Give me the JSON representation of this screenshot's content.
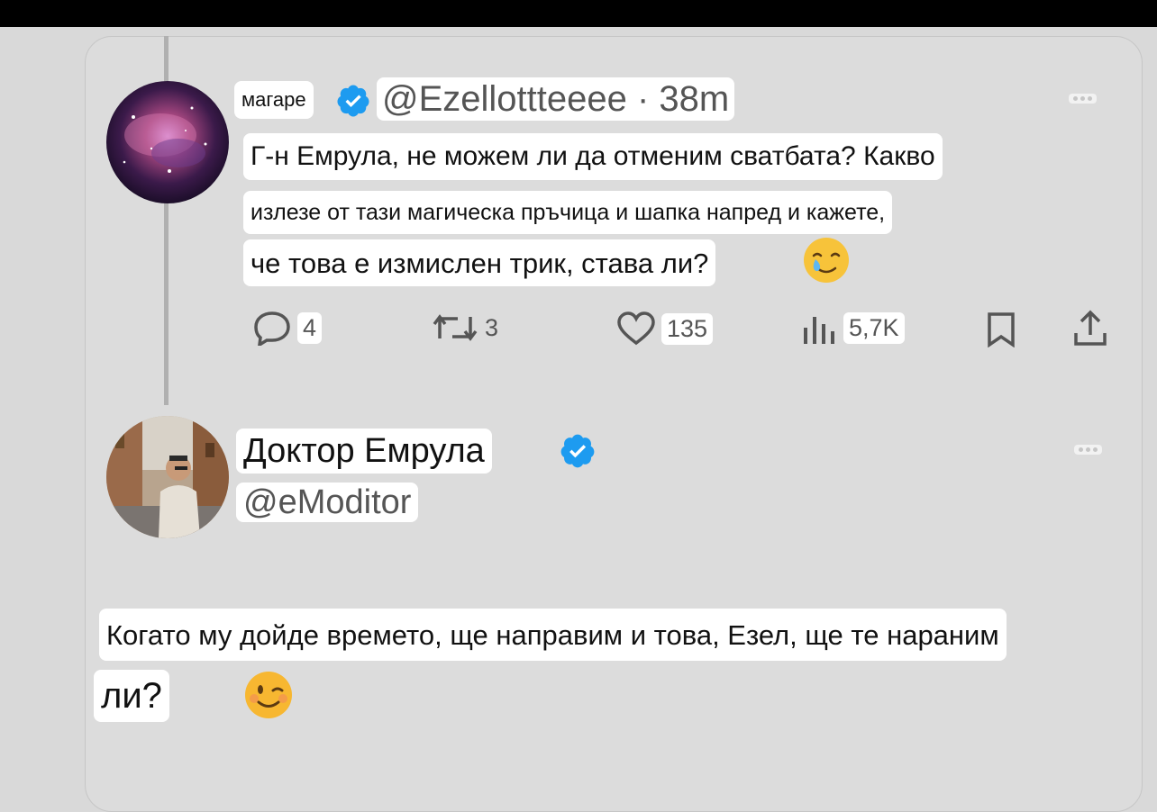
{
  "tweet1": {
    "display_name": "магаре",
    "handle_time": "@Ezellottteeee · 38m",
    "text_line1": "Г-н Емрула, не можем ли да отменим сватбата? Какво",
    "text_line2": "излезе от тази магическа пръчица и шапка напред и кажете,",
    "text_line3": "че това е измислен трик, става ли?",
    "emoji_icon": "crying-smile-emoji",
    "actions": {
      "replies": "4",
      "retweets": "3",
      "likes": "135",
      "views": "5,7K"
    }
  },
  "tweet2": {
    "display_name": "Доктор Емрула",
    "handle": "@eModitor",
    "text_line1": "Когато му дойде времето, ще направим и това, Езел, ще те нараним",
    "text_line2": "ли?",
    "emoji_icon": "winking-face-emoji"
  },
  "colors": {
    "verified": "#1d9bf0",
    "background": "#d9d9d9",
    "label_bg": "#ffffff"
  }
}
